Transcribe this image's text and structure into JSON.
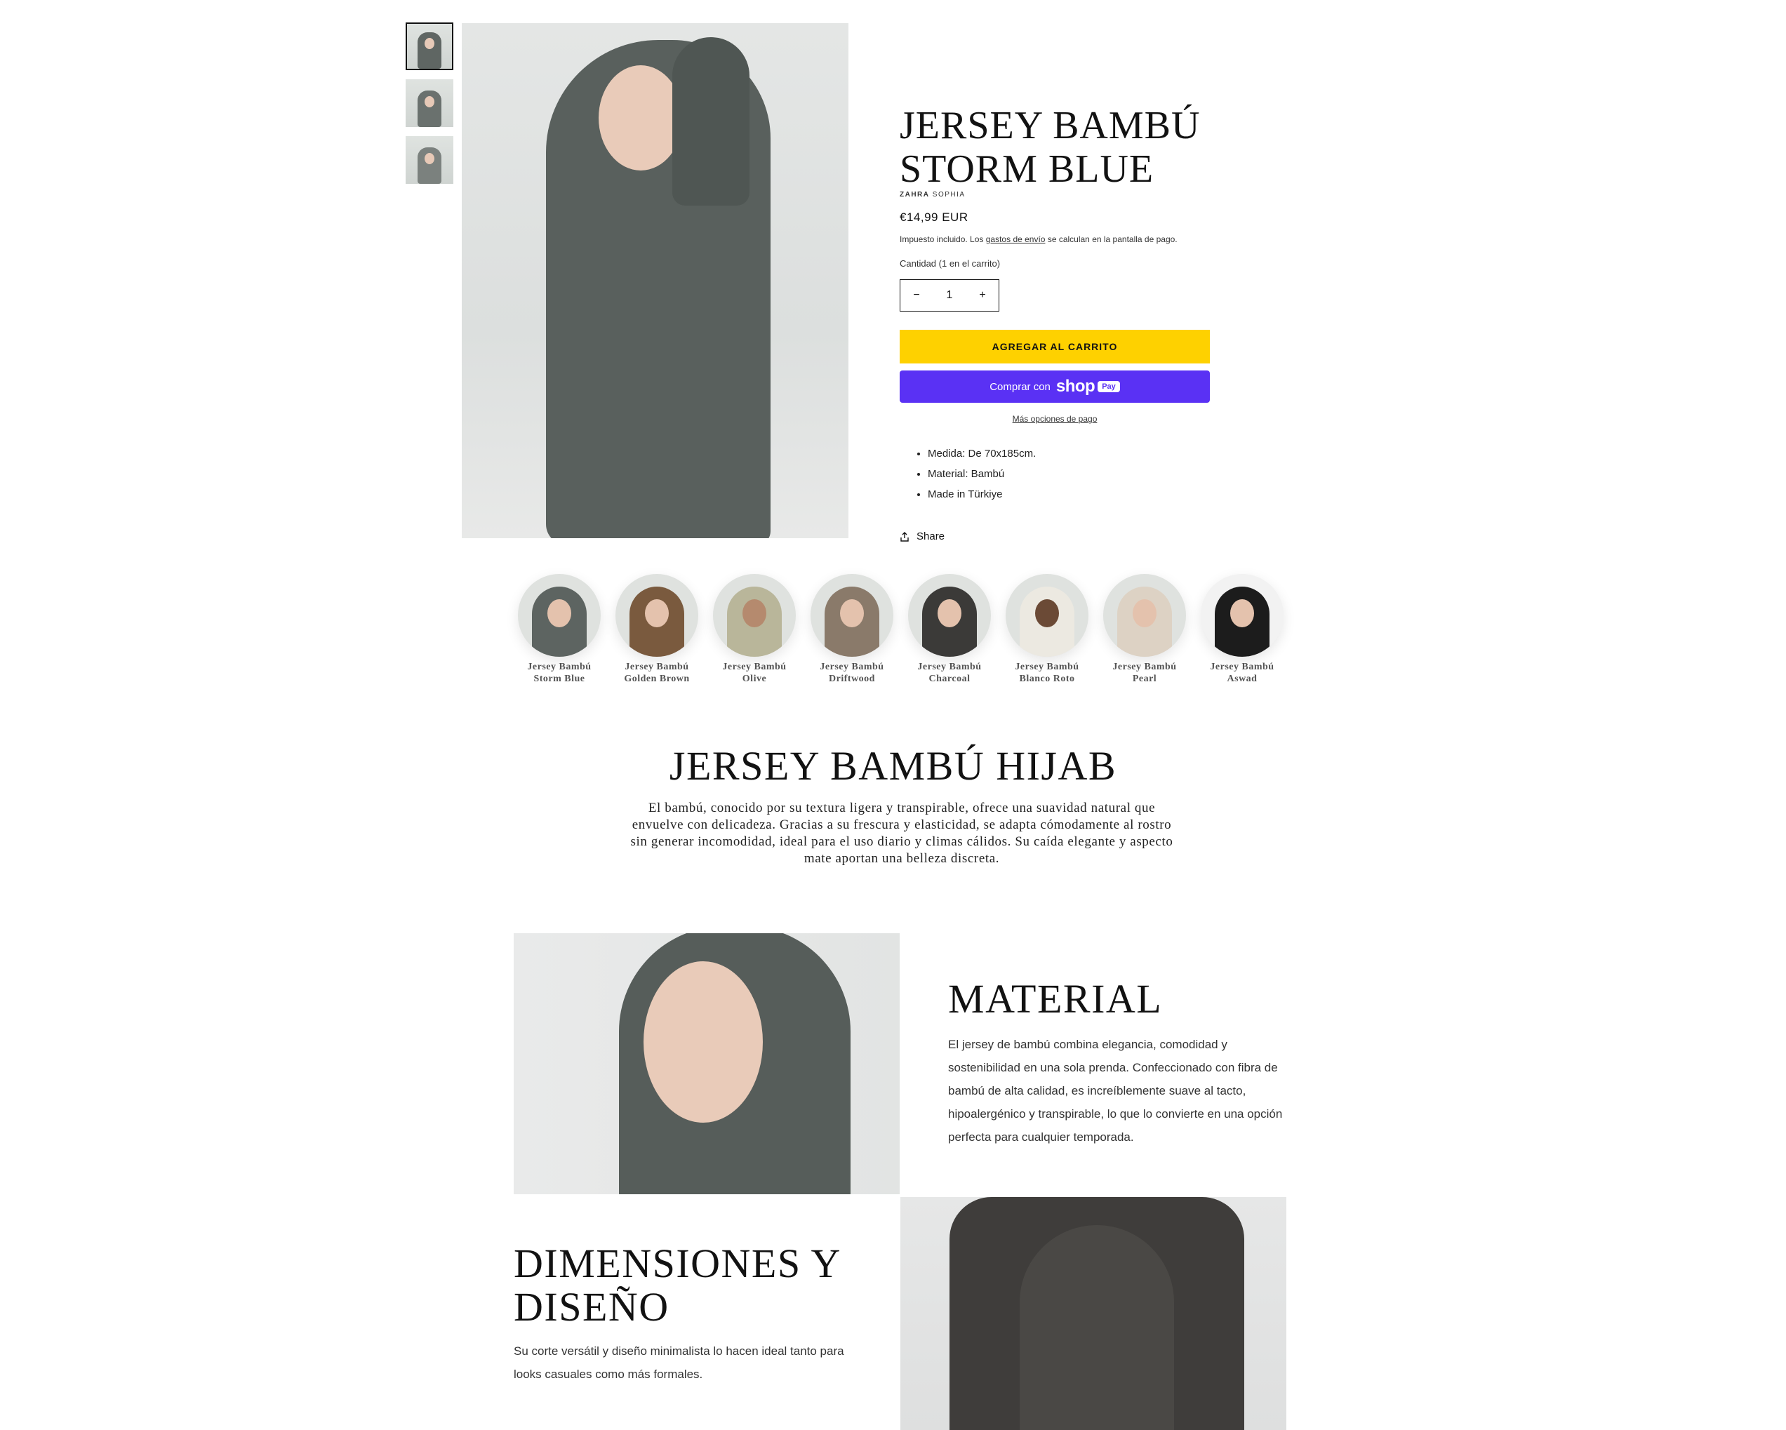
{
  "product": {
    "title": "JERSEY BAMBÚ STORM BLUE",
    "vendor_bold": "ZAHRA",
    "vendor_rest": "SOPHIA",
    "price": "€14,99 EUR",
    "tax_prefix": "Impuesto incluido. Los ",
    "tax_link": "gastos de envío",
    "tax_suffix": " se calculan en la pantalla de pago.",
    "quantity_label": "Cantidad (1 en el carrito)",
    "quantity_value": "1",
    "minus": "−",
    "plus": "+",
    "add_to_cart": "AGREGAR AL CARRITO",
    "shop_prefix": "Comprar con",
    "shop_word": "shop",
    "pay_word": "Pay",
    "more_payment": "Más opciones de pago",
    "bullets": [
      "Medida: De 70x185cm.",
      "Material: Bambú",
      "Made in Türkiye"
    ],
    "share": "Share"
  },
  "colors": {
    "accent_button": "#fed100",
    "shop_pay": "#5a31f4"
  },
  "swatches": [
    {
      "line1": "Jersey Bambú",
      "line2": "Storm Blue",
      "color": "#5d6461"
    },
    {
      "line1": "Jersey Bambú",
      "line2": "Golden Brown",
      "color": "#7a5a3e"
    },
    {
      "line1": "Jersey Bambú",
      "line2": "Olive",
      "color": "#b9b69a"
    },
    {
      "line1": "Jersey Bambú",
      "line2": "Driftwood",
      "color": "#8a7a6a"
    },
    {
      "line1": "Jersey Bambú",
      "line2": "Charcoal",
      "color": "#3b3a38"
    },
    {
      "line1": "Jersey Bambú",
      "line2": "Blanco Roto",
      "color": "#ece9e1"
    },
    {
      "line1": "Jersey Bambú",
      "line2": "Pearl",
      "color": "#ddd2c4"
    },
    {
      "line1": "Jersey Bambú",
      "line2": "Aswad",
      "color": "#1c1c1c"
    }
  ],
  "hijab_section": {
    "title": "JERSEY BAMBÚ HIJAB",
    "text": "El bambú, conocido por su textura ligera y transpirable, ofrece una suavidad natural que envuelve con delicadeza. Gracias a su frescura y elasticidad, se adapta cómodamente al rostro sin generar incomodidad, ideal para el uso diario y climas cálidos. Su caída elegante y aspecto mate aportan una belleza discreta."
  },
  "material_section": {
    "title": "MATERIAL",
    "text": "El jersey de bambú combina elegancia, comodidad y sostenibilidad en una sola prenda. Confeccionado con fibra de bambú de alta calidad, es increíblemente suave al tacto, hipoalergénico y transpirable, lo que lo convierte en una opción perfecta para cualquier temporada."
  },
  "dimensions_section": {
    "title": "DIMENSIONES Y DISEÑO",
    "text": "Su corte versátil y diseño minimalista lo hacen ideal tanto para looks casuales como más formales."
  }
}
